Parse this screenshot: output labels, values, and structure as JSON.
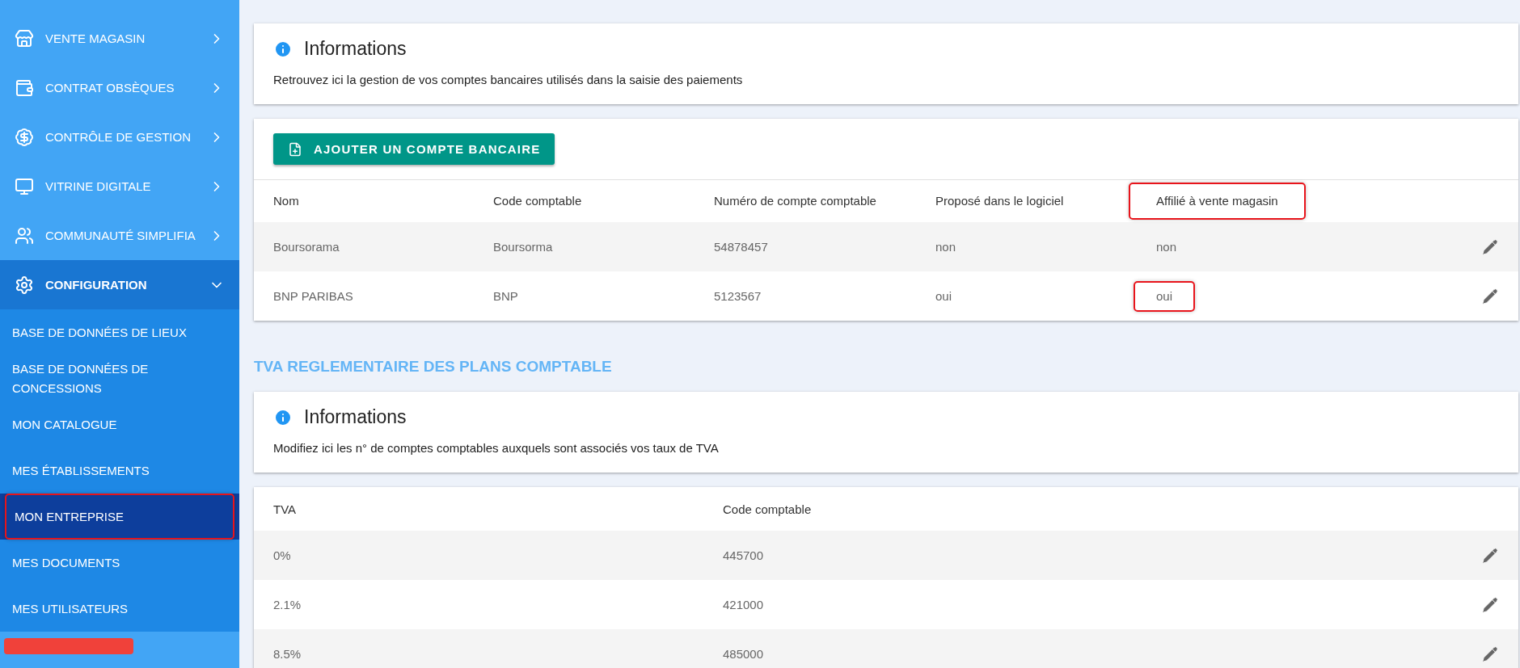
{
  "sidebar": {
    "items": [
      {
        "label": "VENTE MAGASIN",
        "expanded": false
      },
      {
        "label": "CONTRAT OBSÈQUES",
        "expanded": false
      },
      {
        "label": "CONTRÔLE DE GESTION",
        "expanded": false
      },
      {
        "label": "VITRINE DIGITALE",
        "expanded": false
      },
      {
        "label": "COMMUNAUTÉ SIMPLIFIA",
        "expanded": false
      },
      {
        "label": "CONFIGURATION",
        "expanded": true,
        "children": [
          {
            "label": "BASE DE DONNÉES DE LIEUX",
            "selected": false,
            "annotated": false
          },
          {
            "label": "BASE DE DONNÉES DE CONCESSIONS",
            "selected": false,
            "annotated": false
          },
          {
            "label": "MON CATALOGUE",
            "selected": false,
            "annotated": false
          },
          {
            "label": "MES ÉTABLISSEMENTS",
            "selected": false,
            "annotated": false
          },
          {
            "label": "MON ENTREPRISE",
            "selected": true,
            "annotated": true
          },
          {
            "label": "MES DOCUMENTS",
            "selected": false,
            "annotated": false
          },
          {
            "label": "MES UTILISATEURS",
            "selected": false,
            "annotated": false
          }
        ]
      }
    ]
  },
  "bank_info": {
    "title": "Informations",
    "text": "Retrouvez ici la gestion de vos comptes bancaires utilisés dans la saisie des paiements"
  },
  "bank_table": {
    "add_button": "AJOUTER UN COMPTE BANCAIRE",
    "columns": [
      {
        "label": "Nom",
        "annotated": false
      },
      {
        "label": "Code comptable",
        "annotated": false
      },
      {
        "label": "Numéro de compte comptable",
        "annotated": false
      },
      {
        "label": "Proposé dans le logiciel",
        "annotated": false
      },
      {
        "label": "Affilié à vente magasin",
        "annotated": true
      }
    ],
    "rows": [
      {
        "cells": [
          {
            "text": "Boursorama",
            "annotated": false
          },
          {
            "text": "Boursorma",
            "annotated": false
          },
          {
            "text": "54878457",
            "annotated": false
          },
          {
            "text": "non",
            "annotated": false
          },
          {
            "text": "non",
            "annotated": false
          }
        ]
      },
      {
        "cells": [
          {
            "text": "BNP PARIBAS",
            "annotated": false
          },
          {
            "text": "BNP",
            "annotated": false
          },
          {
            "text": "5123567",
            "annotated": false
          },
          {
            "text": "oui",
            "annotated": false
          },
          {
            "text": "oui",
            "annotated": true
          }
        ]
      }
    ]
  },
  "tva_section": {
    "title": "TVA REGLEMENTAIRE DES PLANS COMPTABLE"
  },
  "tva_info": {
    "title": "Informations",
    "text": "Modifiez ici les n° de comptes comptables auxquels sont associés vos taux de TVA"
  },
  "tva_table": {
    "columns": [
      "TVA",
      "Code comptable"
    ],
    "rows": [
      [
        "0%",
        "445700"
      ],
      [
        "2.1%",
        "421000"
      ],
      [
        "8.5%",
        "485000"
      ]
    ]
  }
}
